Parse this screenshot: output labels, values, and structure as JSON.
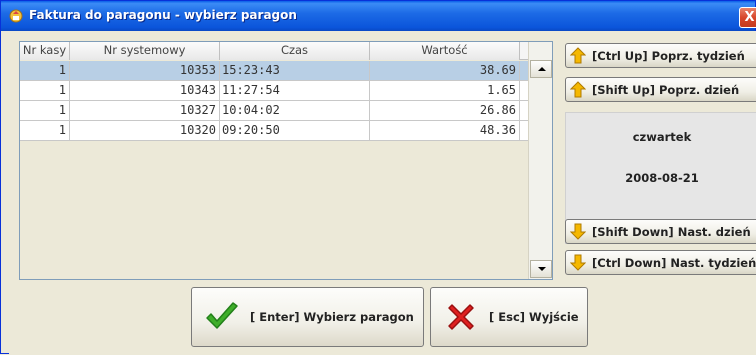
{
  "window": {
    "title": "Faktura do paragonu - wybierz paragon",
    "close_label": "X"
  },
  "table": {
    "columns": [
      "Nr kasy",
      "Nr systemowy",
      "Czas",
      "Wartość"
    ],
    "rows": [
      {
        "nr_kasy": "1",
        "nr_systemowy": "10353",
        "czas": "15:23:43",
        "wartosc": "38.69",
        "selected": true
      },
      {
        "nr_kasy": "1",
        "nr_systemowy": "10343",
        "czas": "11:27:54",
        "wartosc": "1.65",
        "selected": false
      },
      {
        "nr_kasy": "1",
        "nr_systemowy": "10327",
        "czas": "10:04:02",
        "wartosc": "26.86",
        "selected": false
      },
      {
        "nr_kasy": "1",
        "nr_systemowy": "10320",
        "czas": "09:20:50",
        "wartosc": "48.36",
        "selected": false
      }
    ]
  },
  "nav": {
    "prev_week": "[Ctrl Up] Poprz. tydzień",
    "prev_day": "[Shift Up] Poprz. dzień",
    "next_day": "[Shift Down] Nast. dzień",
    "next_week": "[Ctrl Down] Nast. tydzień"
  },
  "day": {
    "name": "czwartek",
    "date": "2008-08-21"
  },
  "actions": {
    "select_label": "[ Enter] Wybierz paragon",
    "exit_label": "[ Esc] Wyjście"
  },
  "colors": {
    "titlebar": "#0b55db",
    "selected_row": "#b8cfe5",
    "arrow_icon": "#f5b800",
    "check_icon": "#3fae2a",
    "cross_icon": "#e02020"
  },
  "icons": {
    "up": "arrow-up-icon",
    "down": "arrow-down-icon",
    "select": "checkmark-icon",
    "exit": "cross-icon",
    "app": "app-icon"
  }
}
